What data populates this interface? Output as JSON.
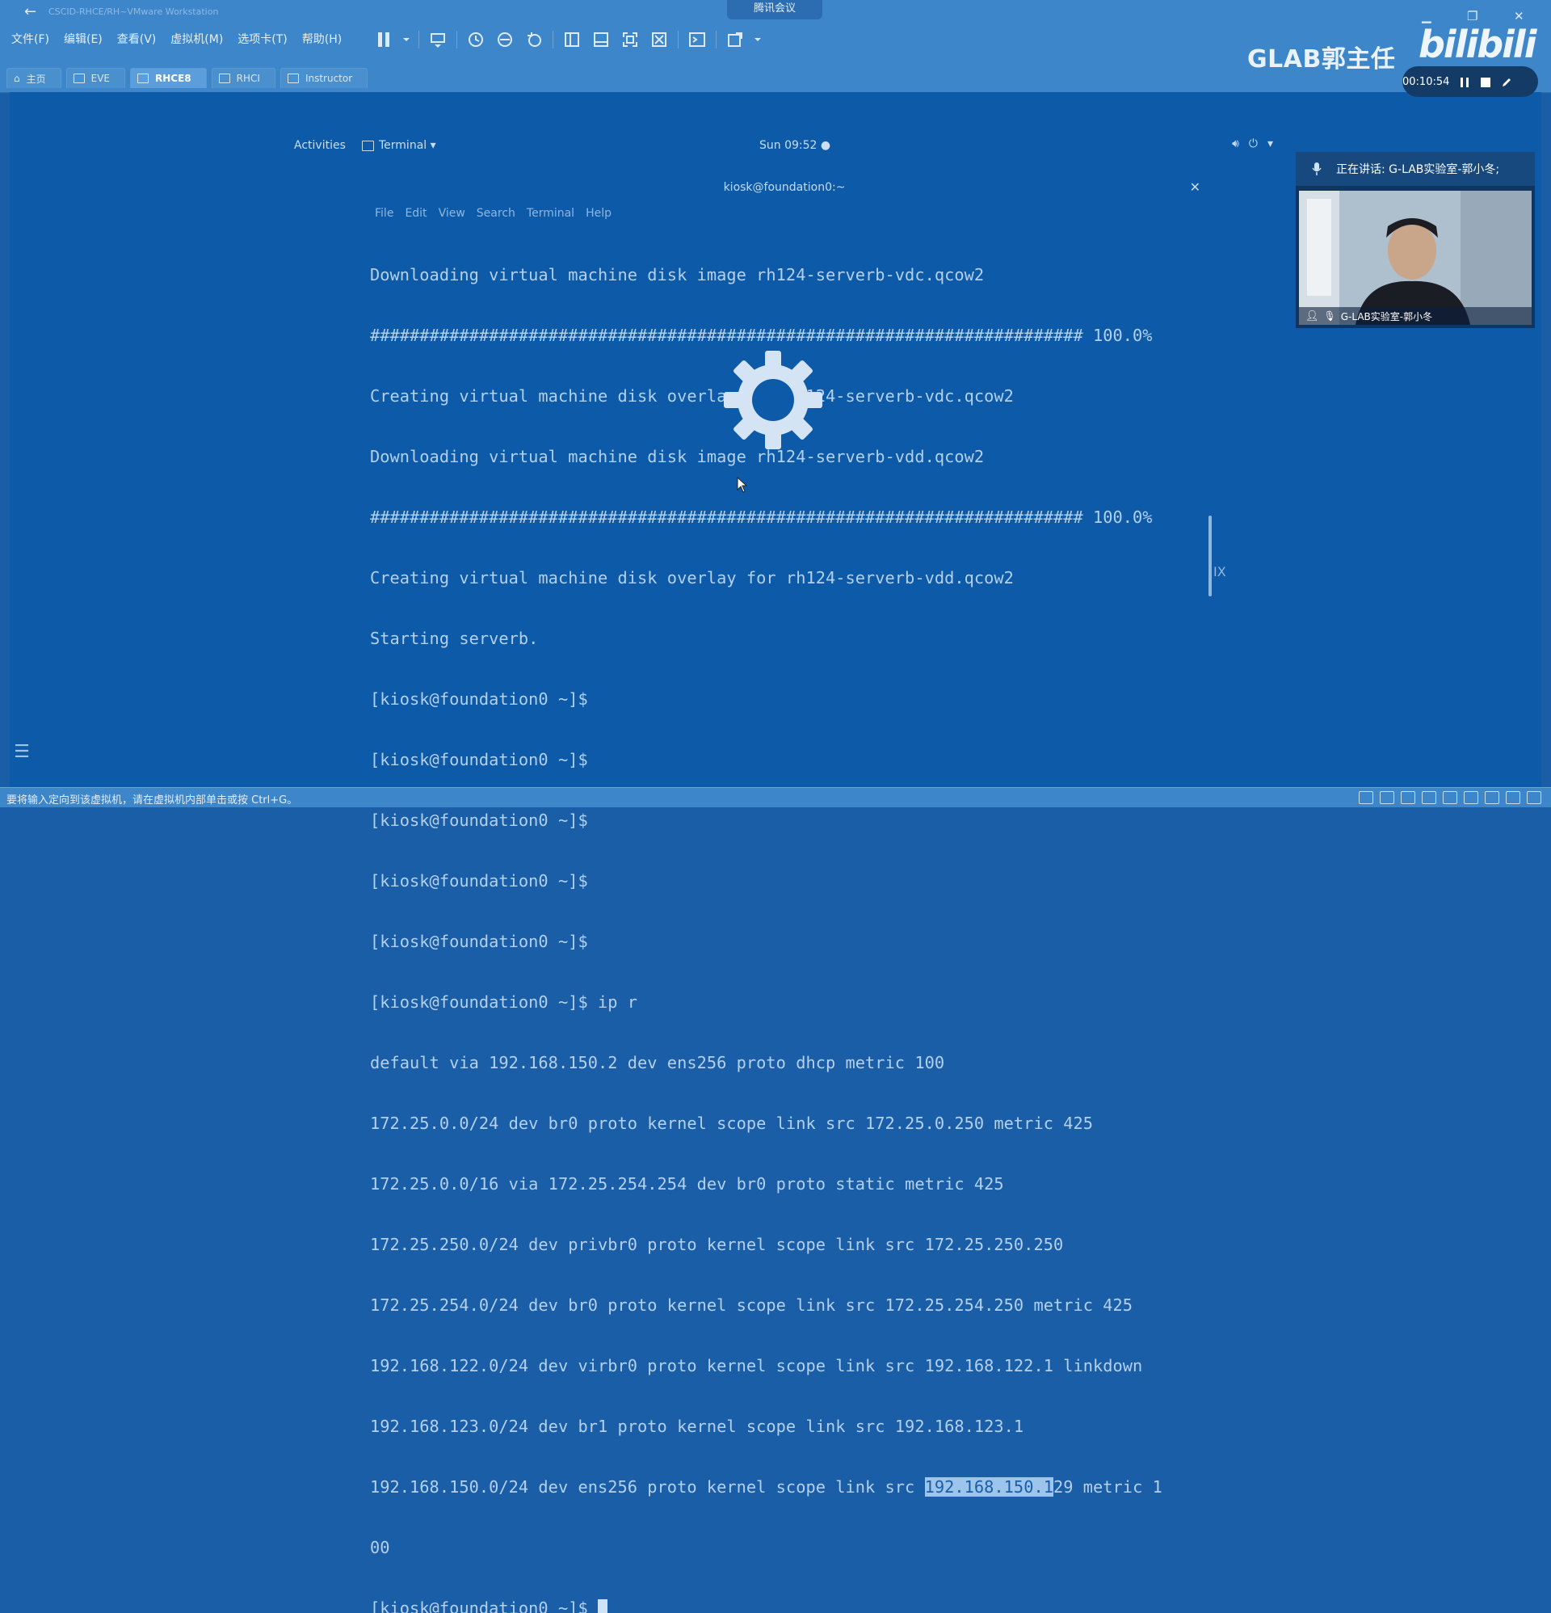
{
  "window": {
    "back_icon": "back-arrow-icon",
    "title_faded": "CSCID-RHCE/RH~VMware Workstation",
    "meeting_badge": "腾讯会议",
    "controls": [
      "minimize-icon",
      "restore-icon",
      "close-icon"
    ]
  },
  "menu": {
    "items": [
      "文件(F)",
      "编辑(E)",
      "查看(V)",
      "虚拟机(M)",
      "选项卡(T)",
      "帮助(H)"
    ]
  },
  "toolbar": {
    "icons": [
      "pause-icon",
      "send-keys-icon",
      "snapshot-icon",
      "revert-snapshot-icon",
      "snapshot-manager-icon",
      "library-icon",
      "thumbnail-icon",
      "fullscreen-icon",
      "unity-icon",
      "console-icon",
      "stretch-icon"
    ]
  },
  "tabs": [
    {
      "label": "主页",
      "active": false
    },
    {
      "label": "EVE",
      "active": false
    },
    {
      "label": "RHCE8",
      "active": true
    },
    {
      "label": "RHCI",
      "active": false
    },
    {
      "label": "Instructor",
      "active": false
    }
  ],
  "gnome": {
    "activities": "Activities",
    "app_menu": "Terminal ▾",
    "clock": "Sun 09:52 ●",
    "tray": [
      "volume-icon",
      "power-icon",
      "chevron-down-icon"
    ]
  },
  "terminal": {
    "title": "kiosk@foundation0:~",
    "menu": [
      "File",
      "Edit",
      "View",
      "Search",
      "Terminal",
      "Help"
    ],
    "lines": [
      "Downloading virtual machine disk image rh124-serverb-vdc.qcow2",
      "######################################################################## 100.0%",
      "Creating virtual machine disk overlay for rh124-serverb-vdc.qcow2",
      "Downloading virtual machine disk image rh124-serverb-vdd.qcow2",
      "######################################################################## 100.0%",
      "Creating virtual machine disk overlay for rh124-serverb-vdd.qcow2",
      "Starting serverb.",
      "[kiosk@foundation0 ~]$",
      "[kiosk@foundation0 ~]$",
      "[kiosk@foundation0 ~]$",
      "[kiosk@foundation0 ~]$",
      "[kiosk@foundation0 ~]$",
      "[kiosk@foundation0 ~]$ ip r",
      "default via 192.168.150.2 dev ens256 proto dhcp metric 100",
      "172.25.0.0/24 dev br0 proto kernel scope link src 172.25.0.250 metric 425",
      "172.25.0.0/16 via 172.25.254.254 dev br0 proto static metric 425",
      "172.25.250.0/24 dev privbr0 proto kernel scope link src 172.25.250.250",
      "172.25.254.0/24 dev br0 proto kernel scope link src 172.25.254.250 metric 425",
      "192.168.122.0/24 dev virbr0 proto kernel scope link src 192.168.122.1 linkdown",
      "192.168.123.0/24 dev br1 proto kernel scope link src 192.168.123.1"
    ],
    "last_route_pre": "192.168.150.0/24 dev ens256 proto kernel scope link src ",
    "last_route_highlight": "192.168.150.1",
    "last_route_post": "29 metric 1",
    "wrap_line": "00",
    "prompt": "[kiosk@foundation0 ~]$ ",
    "side_mark": "IX"
  },
  "status": {
    "text": "要将输入定向到该虚拟机，请在虚拟机内部单击或按 Ctrl+G。"
  },
  "overlay": {
    "watermark_glab": "GLAB郭主任",
    "watermark_bili": "bilibili",
    "rec_time": "00:10:54",
    "speaking_text": "正在讲话: G-LAB实验室-郭小冬;",
    "cam_name": "G-LAB实验室-郭小冬"
  },
  "colors": {
    "tint": "#1b5ea8",
    "chrome": "#3d86c9",
    "highlight": "#9dc4ea"
  }
}
